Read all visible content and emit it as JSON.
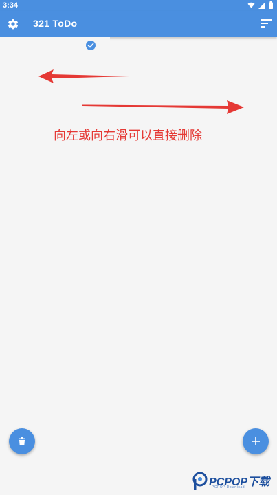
{
  "status_bar": {
    "time": "3:34",
    "icons": [
      "wifi-icon",
      "signal-icon",
      "battery-icon"
    ]
  },
  "app_bar": {
    "title": "321 ToDo",
    "left_icon": "gear-icon",
    "right_icon": "sort-icon"
  },
  "todo_list": {
    "items": [
      {
        "text": "",
        "done": true
      }
    ]
  },
  "overlay": {
    "hint_text": "向左或向右滑可以直接删除",
    "arrow_color": "#e53935"
  },
  "fabs": {
    "delete_icon": "trash-icon",
    "add_icon": "plus-icon",
    "color": "#4a8fe0"
  },
  "watermark": {
    "brand": "PCPOP下载",
    "sub": "PCPOP Download"
  },
  "colors": {
    "primary": "#4a8fe0",
    "background": "#f5f5f5",
    "hint": "#e53935"
  }
}
